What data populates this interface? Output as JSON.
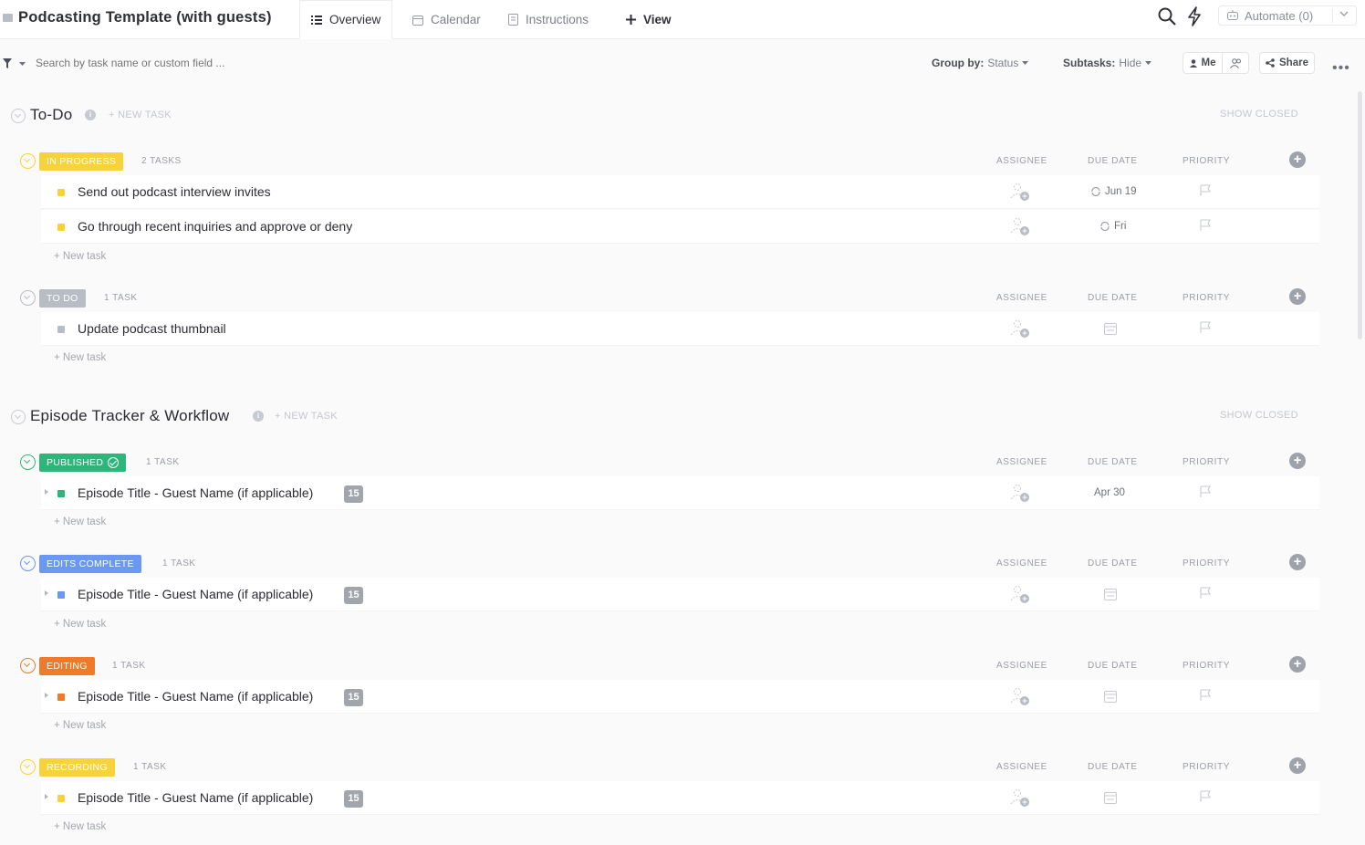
{
  "app": {
    "title": "Podcasting Template (with guests)"
  },
  "tabs": [
    {
      "label": "Overview",
      "icon": "list-icon",
      "active": true
    },
    {
      "label": "Calendar",
      "icon": "calendar-icon"
    },
    {
      "label": "Instructions",
      "icon": "doc-icon"
    },
    {
      "label": "View",
      "icon": "plus-icon"
    }
  ],
  "toolbar": {
    "automate_label": "Automate (0)",
    "search_placeholder": "Search by task name or custom field ...",
    "group_by_label": "Group by:",
    "group_by_value": "Status",
    "subtasks_label": "Subtasks:",
    "subtasks_value": "Hide",
    "me_label": "Me",
    "share_label": "Share"
  },
  "columns": {
    "assignee": "ASSIGNEE",
    "due_date": "DUE DATE",
    "priority": "PRIORITY"
  },
  "labels": {
    "new_task_head": "+ NEW TASK",
    "show_closed": "SHOW CLOSED",
    "new_task_row": "+ New task"
  },
  "colors": {
    "in_progress": "#f7d23a",
    "todo": "#b8bcc4",
    "published": "#2fb57a",
    "edits_complete": "#6b98f2",
    "editing": "#ee7a2a",
    "recording": "#f7d23a"
  },
  "sections": [
    {
      "title": "To-Do",
      "groups": [
        {
          "status": "IN PROGRESS",
          "count": "2 TASKS",
          "color": "#f7d23a",
          "tasks": [
            {
              "name": "Send out podcast interview invites",
              "due": "Jun 19"
            },
            {
              "name": "Go through recent inquiries and approve or deny",
              "due": "Fri"
            }
          ]
        },
        {
          "status": "TO DO",
          "count": "1 TASK",
          "color": "#b8bcc4",
          "tasks": [
            {
              "name": "Update podcast thumbnail"
            }
          ]
        }
      ]
    },
    {
      "title": "Episode Tracker & Workflow",
      "groups": [
        {
          "status": "PUBLISHED",
          "count": "1 TASK",
          "color": "#2fb57a",
          "tasks": [
            {
              "name": "Episode Title - Guest Name (if applicable)",
              "subtasks": "15",
              "due": "Apr 30"
            }
          ]
        },
        {
          "status": "EDITS COMPLETE",
          "count": "1 TASK",
          "color": "#6b98f2",
          "tasks": [
            {
              "name": "Episode Title - Guest Name (if applicable)",
              "subtasks": "15"
            }
          ]
        },
        {
          "status": "EDITING",
          "count": "1 TASK",
          "color": "#ee7a2a",
          "tasks": [
            {
              "name": "Episode Title - Guest Name (if applicable)",
              "subtasks": "15"
            }
          ]
        },
        {
          "status": "RECORDING",
          "count": "1 TASK",
          "color": "#f7d23a",
          "tasks": [
            {
              "name": "Episode Title - Guest Name (if applicable)",
              "subtasks": "15"
            }
          ]
        }
      ]
    }
  ]
}
